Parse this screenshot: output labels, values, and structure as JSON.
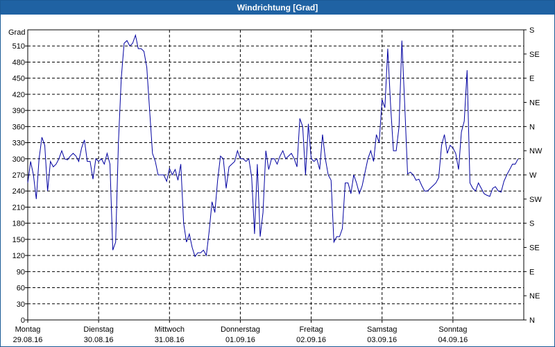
{
  "window": {
    "title": "Windrichtung [Grad]"
  },
  "chart_data": {
    "type": "line",
    "title": "Windrichtung [Grad]",
    "ylabel": "Grad",
    "ylim": [
      0,
      540
    ],
    "y_ticks": [
      0,
      30,
      60,
      90,
      120,
      150,
      180,
      210,
      240,
      270,
      300,
      330,
      360,
      390,
      420,
      450,
      480,
      510
    ],
    "right_axis_labels": [
      "N",
      "NE",
      "E",
      "SE",
      "S",
      "SW",
      "W",
      "NW",
      "N",
      "NE",
      "E",
      "SE",
      "S"
    ],
    "x_ticks": [
      {
        "day": "Montag",
        "date": "29.08.16",
        "t": 0
      },
      {
        "day": "Dienstag",
        "date": "30.08.16",
        "t": 1
      },
      {
        "day": "Mittwoch",
        "date": "31.08.16",
        "t": 2
      },
      {
        "day": "Donnerstag",
        "date": "01.09.16",
        "t": 3
      },
      {
        "day": "Freitag",
        "date": "02.09.16",
        "t": 4
      },
      {
        "day": "Samstag",
        "date": "03.09.16",
        "t": 5
      },
      {
        "day": "Sonntag",
        "date": "04.09.16",
        "t": 6
      }
    ],
    "x_range_days": [
      0,
      7
    ],
    "grid": true,
    "line_color": "#0000a0",
    "series": [
      {
        "name": "",
        "points": [
          [
            0.0,
            255
          ],
          [
            0.04,
            295
          ],
          [
            0.08,
            270
          ],
          [
            0.12,
            225
          ],
          [
            0.16,
            300
          ],
          [
            0.2,
            340
          ],
          [
            0.24,
            325
          ],
          [
            0.28,
            240
          ],
          [
            0.32,
            295
          ],
          [
            0.36,
            285
          ],
          [
            0.4,
            290
          ],
          [
            0.44,
            300
          ],
          [
            0.48,
            315
          ],
          [
            0.52,
            300
          ],
          [
            0.56,
            298
          ],
          [
            0.6,
            305
          ],
          [
            0.64,
            310
          ],
          [
            0.68,
            305
          ],
          [
            0.72,
            295
          ],
          [
            0.76,
            320
          ],
          [
            0.8,
            335
          ],
          [
            0.84,
            295
          ],
          [
            0.88,
            295
          ],
          [
            0.92,
            262
          ],
          [
            0.96,
            300
          ],
          [
            1.0,
            295
          ],
          [
            1.04,
            300
          ],
          [
            1.08,
            290
          ],
          [
            1.12,
            310
          ],
          [
            1.16,
            290
          ],
          [
            1.2,
            130
          ],
          [
            1.24,
            145
          ],
          [
            1.28,
            330
          ],
          [
            1.32,
            450
          ],
          [
            1.36,
            515
          ],
          [
            1.4,
            520
          ],
          [
            1.44,
            510
          ],
          [
            1.48,
            515
          ],
          [
            1.52,
            530
          ],
          [
            1.56,
            505
          ],
          [
            1.6,
            505
          ],
          [
            1.64,
            500
          ],
          [
            1.68,
            470
          ],
          [
            1.72,
            390
          ],
          [
            1.76,
            310
          ],
          [
            1.8,
            295
          ],
          [
            1.84,
            270
          ],
          [
            1.88,
            270
          ],
          [
            1.92,
            270
          ],
          [
            1.96,
            258
          ],
          [
            2.0,
            282
          ],
          [
            2.04,
            270
          ],
          [
            2.08,
            280
          ],
          [
            2.12,
            260
          ],
          [
            2.16,
            290
          ],
          [
            2.2,
            180
          ],
          [
            2.24,
            145
          ],
          [
            2.28,
            160
          ],
          [
            2.32,
            135
          ],
          [
            2.36,
            118
          ],
          [
            2.4,
            125
          ],
          [
            2.44,
            125
          ],
          [
            2.48,
            130
          ],
          [
            2.52,
            120
          ],
          [
            2.56,
            165
          ],
          [
            2.6,
            220
          ],
          [
            2.64,
            200
          ],
          [
            2.68,
            260
          ],
          [
            2.72,
            305
          ],
          [
            2.76,
            300
          ],
          [
            2.8,
            245
          ],
          [
            2.84,
            285
          ],
          [
            2.88,
            290
          ],
          [
            2.92,
            295
          ],
          [
            2.96,
            315
          ],
          [
            3.0,
            300
          ],
          [
            3.04,
            300
          ],
          [
            3.08,
            295
          ],
          [
            3.12,
            300
          ],
          [
            3.16,
            265
          ],
          [
            3.2,
            160
          ],
          [
            3.24,
            290
          ],
          [
            3.28,
            155
          ],
          [
            3.32,
            200
          ],
          [
            3.36,
            315
          ],
          [
            3.4,
            280
          ],
          [
            3.44,
            300
          ],
          [
            3.48,
            300
          ],
          [
            3.52,
            290
          ],
          [
            3.56,
            305
          ],
          [
            3.6,
            315
          ],
          [
            3.64,
            300
          ],
          [
            3.68,
            305
          ],
          [
            3.72,
            310
          ],
          [
            3.76,
            300
          ],
          [
            3.8,
            285
          ],
          [
            3.84,
            375
          ],
          [
            3.88,
            360
          ],
          [
            3.92,
            270
          ],
          [
            3.96,
            365
          ],
          [
            4.0,
            300
          ],
          [
            4.04,
            295
          ],
          [
            4.08,
            300
          ],
          [
            4.12,
            280
          ],
          [
            4.16,
            345
          ],
          [
            4.2,
            300
          ],
          [
            4.24,
            270
          ],
          [
            4.28,
            260
          ],
          [
            4.32,
            145
          ],
          [
            4.36,
            155
          ],
          [
            4.4,
            155
          ],
          [
            4.44,
            170
          ],
          [
            4.48,
            255
          ],
          [
            4.52,
            255
          ],
          [
            4.56,
            235
          ],
          [
            4.6,
            270
          ],
          [
            4.64,
            255
          ],
          [
            4.68,
            235
          ],
          [
            4.72,
            250
          ],
          [
            4.76,
            275
          ],
          [
            4.8,
            300
          ],
          [
            4.84,
            315
          ],
          [
            4.88,
            295
          ],
          [
            4.92,
            345
          ],
          [
            4.96,
            330
          ],
          [
            5.0,
            410
          ],
          [
            5.04,
            395
          ],
          [
            5.08,
            505
          ],
          [
            5.12,
            400
          ],
          [
            5.16,
            315
          ],
          [
            5.2,
            315
          ],
          [
            5.24,
            360
          ],
          [
            5.28,
            520
          ],
          [
            5.32,
            400
          ],
          [
            5.36,
            272
          ],
          [
            5.4,
            275
          ],
          [
            5.44,
            270
          ],
          [
            5.48,
            260
          ],
          [
            5.52,
            262
          ],
          [
            5.56,
            250
          ],
          [
            5.6,
            240
          ],
          [
            5.64,
            240
          ],
          [
            5.68,
            245
          ],
          [
            5.72,
            250
          ],
          [
            5.76,
            255
          ],
          [
            5.8,
            265
          ],
          [
            5.84,
            325
          ],
          [
            5.88,
            345
          ],
          [
            5.92,
            310
          ],
          [
            5.96,
            325
          ],
          [
            6.0,
            320
          ],
          [
            6.04,
            310
          ],
          [
            6.08,
            280
          ],
          [
            6.12,
            350
          ],
          [
            6.16,
            370
          ],
          [
            6.2,
            465
          ],
          [
            6.24,
            255
          ],
          [
            6.28,
            245
          ],
          [
            6.32,
            240
          ],
          [
            6.36,
            255
          ],
          [
            6.4,
            245
          ],
          [
            6.44,
            235
          ],
          [
            6.48,
            232
          ],
          [
            6.52,
            230
          ],
          [
            6.56,
            245
          ],
          [
            6.6,
            248
          ],
          [
            6.64,
            240
          ],
          [
            6.68,
            238
          ],
          [
            6.72,
            258
          ],
          [
            6.76,
            270
          ],
          [
            6.8,
            280
          ],
          [
            6.84,
            290
          ],
          [
            6.88,
            290
          ],
          [
            6.92,
            300
          ]
        ]
      }
    ]
  }
}
